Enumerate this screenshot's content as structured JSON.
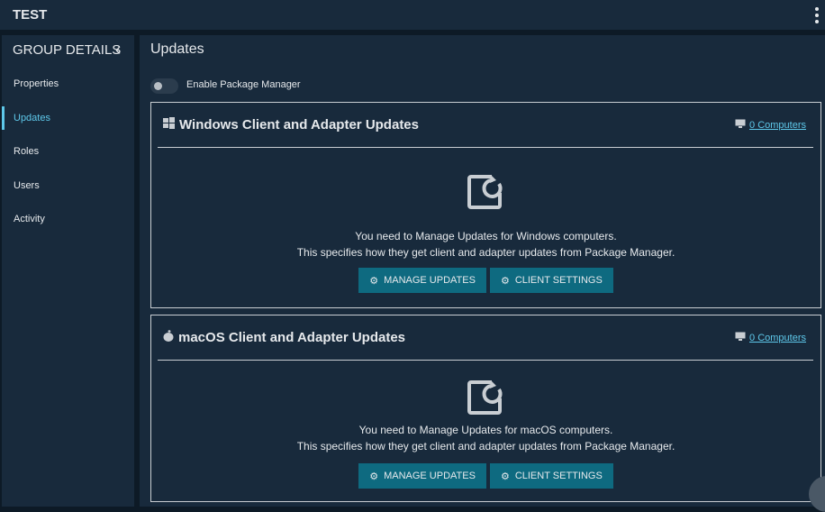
{
  "topbar": {
    "title": "TEST"
  },
  "sidebar": {
    "heading": "GROUP DETAILS",
    "items": [
      {
        "label": "Properties"
      },
      {
        "label": "Updates"
      },
      {
        "label": "Roles"
      },
      {
        "label": "Users"
      },
      {
        "label": "Activity"
      }
    ]
  },
  "main": {
    "title": "Updates",
    "toggle_label": "Enable Package Manager",
    "toggle_on": false,
    "cards": [
      {
        "title": "Windows Client and Adapter Updates",
        "computers": "0 Computers",
        "line1": "You need to Manage Updates for Windows computers.",
        "line2": "This specifies how they get client and adapter updates from Package Manager.",
        "manage": "MANAGE UPDATES",
        "settings": "CLIENT SETTINGS"
      },
      {
        "title": "macOS Client and Adapter Updates",
        "computers": "0 Computers",
        "line1": "You need to Manage Updates for macOS computers.",
        "line2": "This specifies how they get client and adapter updates from Package Manager.",
        "manage": "MANAGE UPDATES",
        "settings": "CLIENT SETTINGS"
      }
    ]
  },
  "colors": {
    "accent": "#5ec8ea",
    "button": "#0e6a80",
    "panel": "#182a3c"
  }
}
